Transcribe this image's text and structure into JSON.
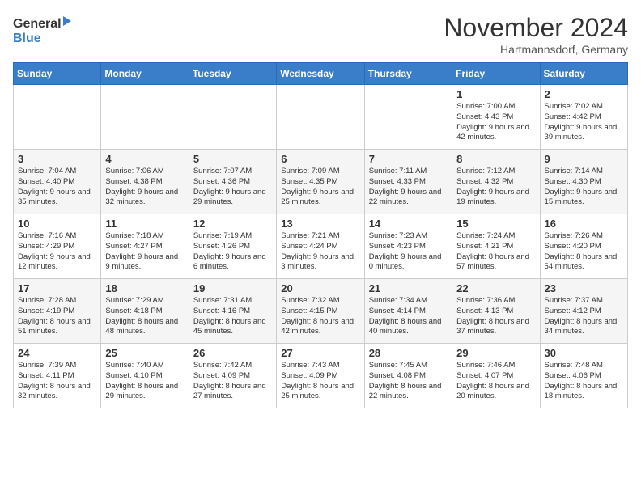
{
  "header": {
    "logo_line1": "General",
    "logo_line2": "Blue",
    "month": "November 2024",
    "location": "Hartmannsdorf, Germany"
  },
  "weekdays": [
    "Sunday",
    "Monday",
    "Tuesday",
    "Wednesday",
    "Thursday",
    "Friday",
    "Saturday"
  ],
  "weeks": [
    [
      {
        "day": "",
        "info": ""
      },
      {
        "day": "",
        "info": ""
      },
      {
        "day": "",
        "info": ""
      },
      {
        "day": "",
        "info": ""
      },
      {
        "day": "",
        "info": ""
      },
      {
        "day": "1",
        "info": "Sunrise: 7:00 AM\nSunset: 4:43 PM\nDaylight: 9 hours\nand 42 minutes."
      },
      {
        "day": "2",
        "info": "Sunrise: 7:02 AM\nSunset: 4:42 PM\nDaylight: 9 hours\nand 39 minutes."
      }
    ],
    [
      {
        "day": "3",
        "info": "Sunrise: 7:04 AM\nSunset: 4:40 PM\nDaylight: 9 hours\nand 35 minutes."
      },
      {
        "day": "4",
        "info": "Sunrise: 7:06 AM\nSunset: 4:38 PM\nDaylight: 9 hours\nand 32 minutes."
      },
      {
        "day": "5",
        "info": "Sunrise: 7:07 AM\nSunset: 4:36 PM\nDaylight: 9 hours\nand 29 minutes."
      },
      {
        "day": "6",
        "info": "Sunrise: 7:09 AM\nSunset: 4:35 PM\nDaylight: 9 hours\nand 25 minutes."
      },
      {
        "day": "7",
        "info": "Sunrise: 7:11 AM\nSunset: 4:33 PM\nDaylight: 9 hours\nand 22 minutes."
      },
      {
        "day": "8",
        "info": "Sunrise: 7:12 AM\nSunset: 4:32 PM\nDaylight: 9 hours\nand 19 minutes."
      },
      {
        "day": "9",
        "info": "Sunrise: 7:14 AM\nSunset: 4:30 PM\nDaylight: 9 hours\nand 15 minutes."
      }
    ],
    [
      {
        "day": "10",
        "info": "Sunrise: 7:16 AM\nSunset: 4:29 PM\nDaylight: 9 hours\nand 12 minutes."
      },
      {
        "day": "11",
        "info": "Sunrise: 7:18 AM\nSunset: 4:27 PM\nDaylight: 9 hours\nand 9 minutes."
      },
      {
        "day": "12",
        "info": "Sunrise: 7:19 AM\nSunset: 4:26 PM\nDaylight: 9 hours\nand 6 minutes."
      },
      {
        "day": "13",
        "info": "Sunrise: 7:21 AM\nSunset: 4:24 PM\nDaylight: 9 hours\nand 3 minutes."
      },
      {
        "day": "14",
        "info": "Sunrise: 7:23 AM\nSunset: 4:23 PM\nDaylight: 9 hours\nand 0 minutes."
      },
      {
        "day": "15",
        "info": "Sunrise: 7:24 AM\nSunset: 4:21 PM\nDaylight: 8 hours\nand 57 minutes."
      },
      {
        "day": "16",
        "info": "Sunrise: 7:26 AM\nSunset: 4:20 PM\nDaylight: 8 hours\nand 54 minutes."
      }
    ],
    [
      {
        "day": "17",
        "info": "Sunrise: 7:28 AM\nSunset: 4:19 PM\nDaylight: 8 hours\nand 51 minutes."
      },
      {
        "day": "18",
        "info": "Sunrise: 7:29 AM\nSunset: 4:18 PM\nDaylight: 8 hours\nand 48 minutes."
      },
      {
        "day": "19",
        "info": "Sunrise: 7:31 AM\nSunset: 4:16 PM\nDaylight: 8 hours\nand 45 minutes."
      },
      {
        "day": "20",
        "info": "Sunrise: 7:32 AM\nSunset: 4:15 PM\nDaylight: 8 hours\nand 42 minutes."
      },
      {
        "day": "21",
        "info": "Sunrise: 7:34 AM\nSunset: 4:14 PM\nDaylight: 8 hours\nand 40 minutes."
      },
      {
        "day": "22",
        "info": "Sunrise: 7:36 AM\nSunset: 4:13 PM\nDaylight: 8 hours\nand 37 minutes."
      },
      {
        "day": "23",
        "info": "Sunrise: 7:37 AM\nSunset: 4:12 PM\nDaylight: 8 hours\nand 34 minutes."
      }
    ],
    [
      {
        "day": "24",
        "info": "Sunrise: 7:39 AM\nSunset: 4:11 PM\nDaylight: 8 hours\nand 32 minutes."
      },
      {
        "day": "25",
        "info": "Sunrise: 7:40 AM\nSunset: 4:10 PM\nDaylight: 8 hours\nand 29 minutes."
      },
      {
        "day": "26",
        "info": "Sunrise: 7:42 AM\nSunset: 4:09 PM\nDaylight: 8 hours\nand 27 minutes."
      },
      {
        "day": "27",
        "info": "Sunrise: 7:43 AM\nSunset: 4:09 PM\nDaylight: 8 hours\nand 25 minutes."
      },
      {
        "day": "28",
        "info": "Sunrise: 7:45 AM\nSunset: 4:08 PM\nDaylight: 8 hours\nand 22 minutes."
      },
      {
        "day": "29",
        "info": "Sunrise: 7:46 AM\nSunset: 4:07 PM\nDaylight: 8 hours\nand 20 minutes."
      },
      {
        "day": "30",
        "info": "Sunrise: 7:48 AM\nSunset: 4:06 PM\nDaylight: 8 hours\nand 18 minutes."
      }
    ]
  ]
}
